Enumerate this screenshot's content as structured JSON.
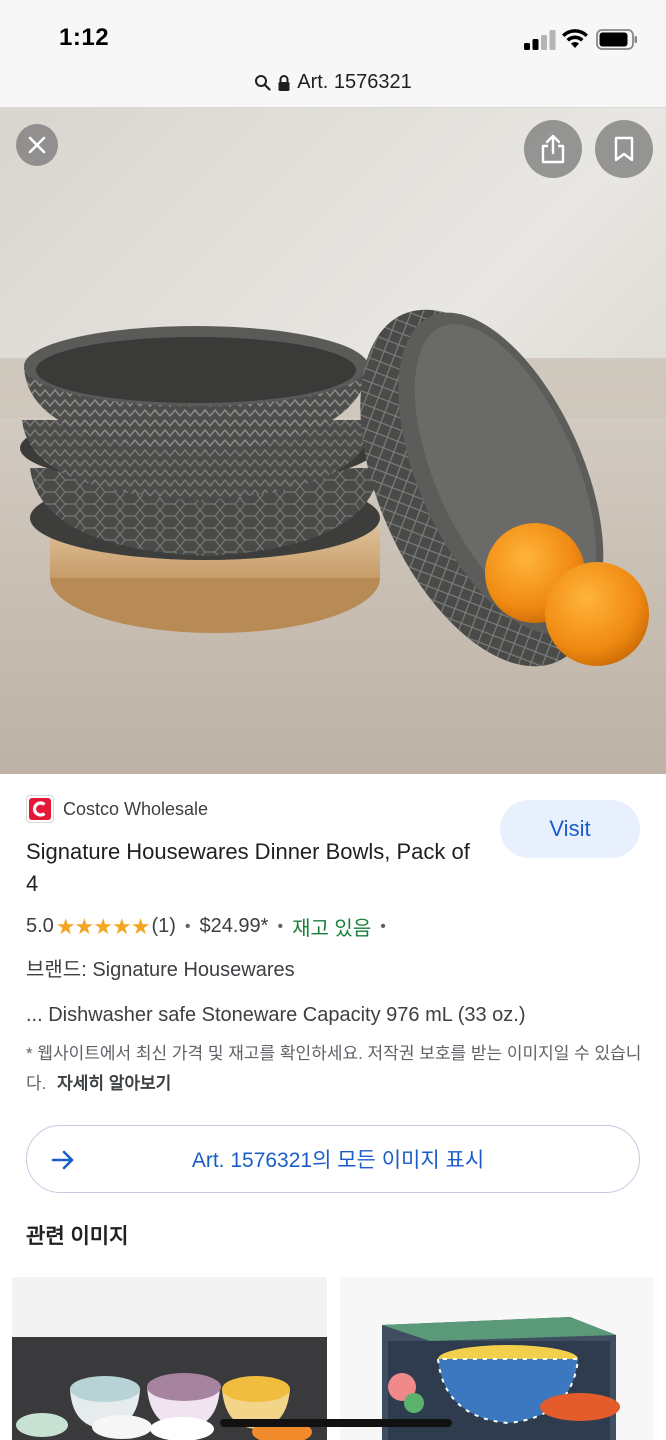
{
  "status_bar": {
    "time": "1:12"
  },
  "url_bar": {
    "text": "Art. 1576321"
  },
  "source": {
    "site_name": "Costco Wholesale"
  },
  "product": {
    "title": "Signature Housewares Dinner Bowls, Pack of 4",
    "rating": "5.0",
    "stars": "★★★★★",
    "review_count": "(1)",
    "price": "$24.99*",
    "stock_status": "재고 있음",
    "brand_line": "브랜드: Signature Housewares",
    "description": "... Dishwasher safe Stoneware Capacity 976 mL (33 oz.)",
    "note": "* 웹사이트에서 최신 가격 및 재고를 확인하세요. 저작권 보호를 받는 이미지일 수 있습니다.",
    "note_link": "자세히 알아보기"
  },
  "actions": {
    "visit_label": "Visit",
    "all_images_label": "Art. 1576321의 모든 이미지 표시"
  },
  "related": {
    "title": "관련 이미지"
  },
  "icons": {
    "close": "close-icon",
    "share": "share-icon",
    "save": "bookmark-icon",
    "search": "search-icon",
    "lock": "lock-icon",
    "arrow": "arrow-right-icon"
  },
  "colors": {
    "accent_blue": "#1a5dc8",
    "visit_bg": "#e8f0fe",
    "star": "#f4a623",
    "in_stock": "#188038",
    "costco_red": "#e31837"
  }
}
